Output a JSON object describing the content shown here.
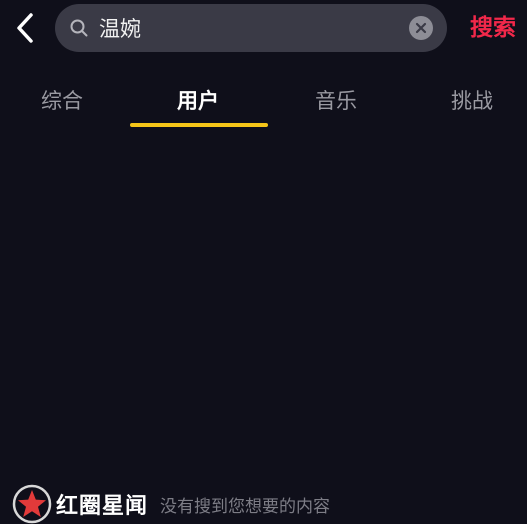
{
  "header": {
    "search_value": "温婉",
    "search_button": "搜索"
  },
  "tabs": [
    {
      "label": "综合",
      "active": false
    },
    {
      "label": "用户",
      "active": true
    },
    {
      "label": "音乐",
      "active": false
    },
    {
      "label": "挑战",
      "active": false
    }
  ],
  "watermark": {
    "brand": "红圈星闻"
  },
  "empty_state": {
    "message": "没有搜到您想要的内容"
  },
  "colors": {
    "background": "#0f0f1a",
    "search_box": "#3a3a46",
    "search_accent": "#f2284a",
    "tab_indicator": "#f5c518"
  },
  "icons": {
    "back": "chevron-left-icon",
    "search": "search-icon",
    "clear": "clear-icon",
    "logo": "star-logo-icon"
  }
}
